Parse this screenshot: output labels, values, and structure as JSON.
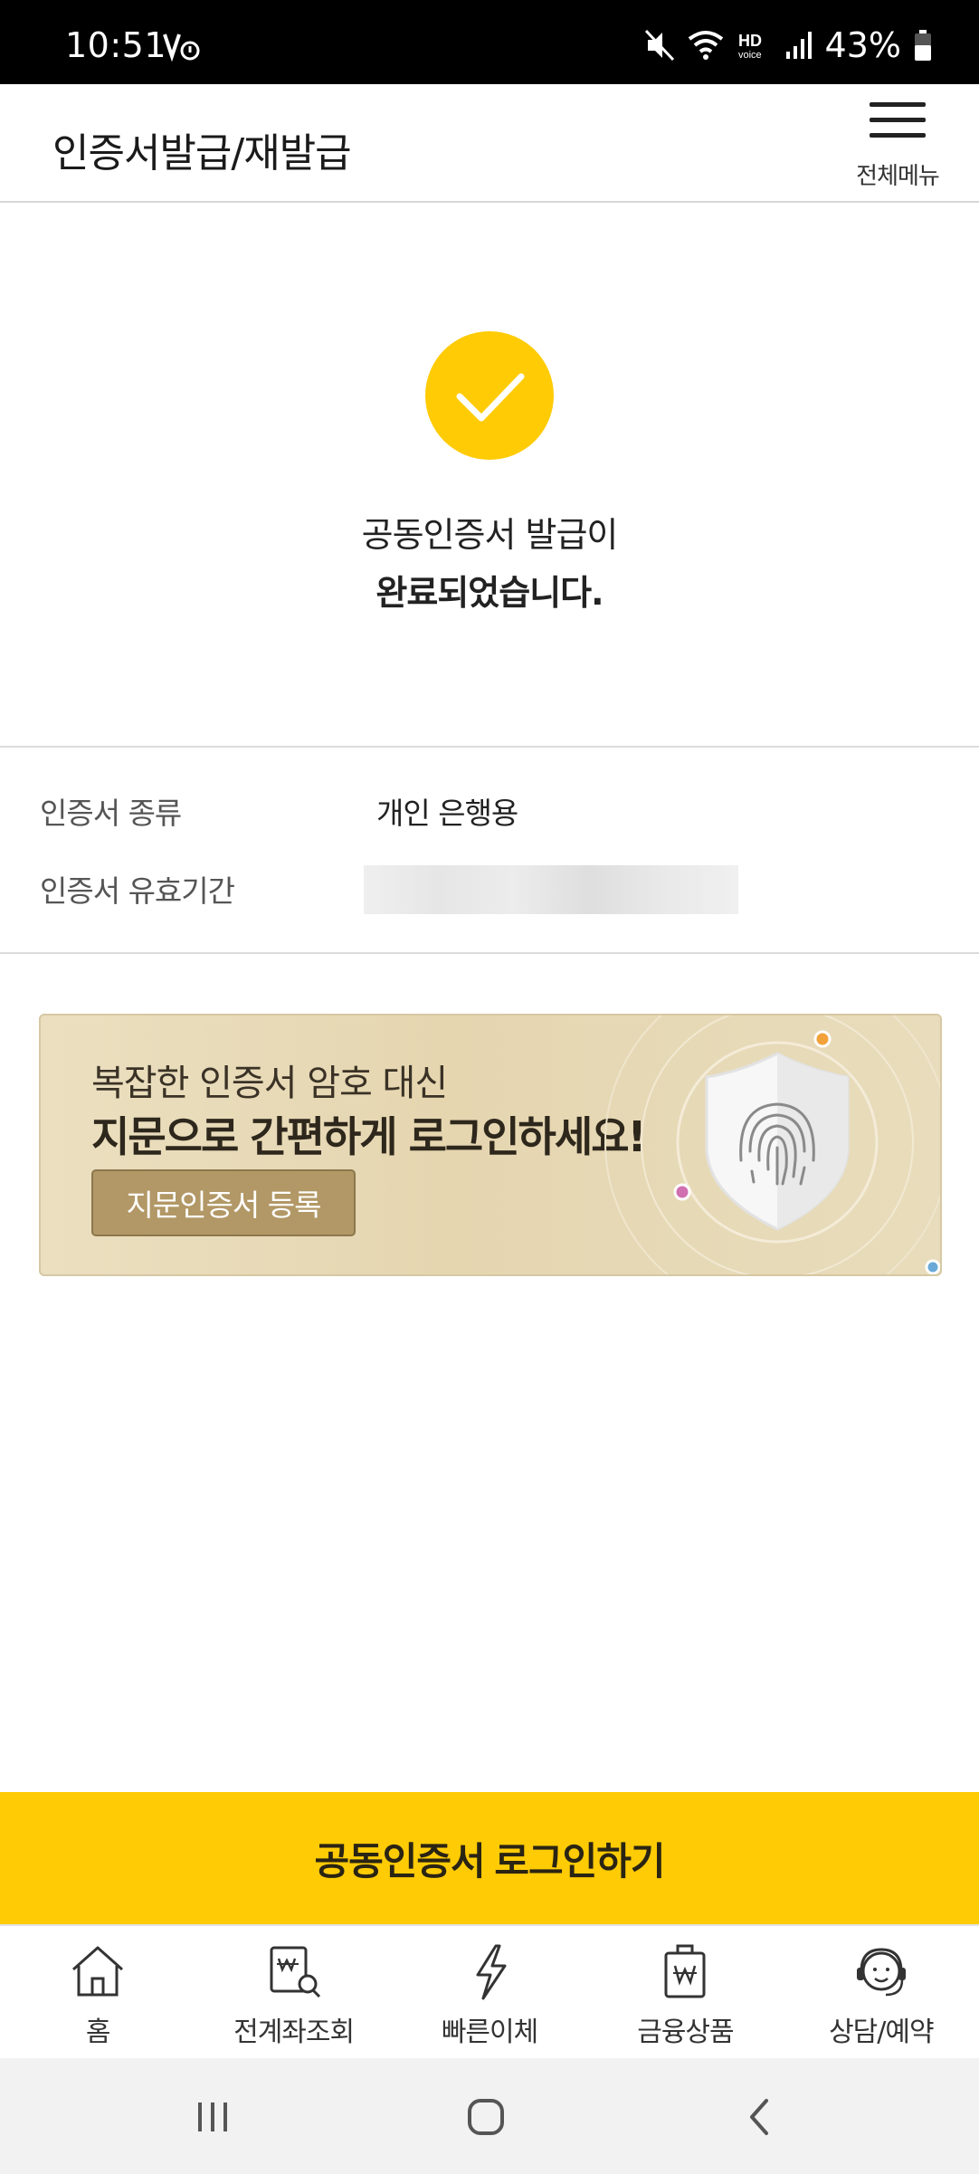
{
  "status_bar": {
    "time": "10:51",
    "battery": "43%",
    "icons": [
      "volte-icon",
      "mute-icon",
      "wifi-icon",
      "hd-voice-icon",
      "signal-icon",
      "battery-icon"
    ]
  },
  "header": {
    "title": "인증서발급/재발급",
    "menu_label": "전체메뉴",
    "menu_icon": "hamburger-icon"
  },
  "success": {
    "icon": "check-icon",
    "line1": "공동인증서 발급이",
    "line2": "완료되었습니다.",
    "accent_color": "#ffcb05"
  },
  "info": {
    "rows": [
      {
        "label": "인증서 종류",
        "value": "개인 은행용"
      },
      {
        "label": "인증서 유효기간",
        "value": ""
      }
    ]
  },
  "banner": {
    "line1": "복잡한 인증서 암호 대신",
    "line2": "지문으로 간편하게 로그인하세요!",
    "button_label": "지문인증서 등록",
    "art_icon": "fingerprint-shield-icon"
  },
  "primary_action": {
    "label": "공동인증서 로그인하기"
  },
  "bottom_nav": {
    "items": [
      {
        "label": "홈",
        "icon": "home-icon"
      },
      {
        "label": "전계좌조회",
        "icon": "account-search-icon"
      },
      {
        "label": "빠른이체",
        "icon": "lightning-icon"
      },
      {
        "label": "금융상품",
        "icon": "product-bag-icon"
      },
      {
        "label": "상담/예약",
        "icon": "consult-headset-icon"
      }
    ]
  },
  "system_nav": {
    "icons": [
      "recents-icon",
      "home-circle-icon",
      "back-icon"
    ]
  }
}
